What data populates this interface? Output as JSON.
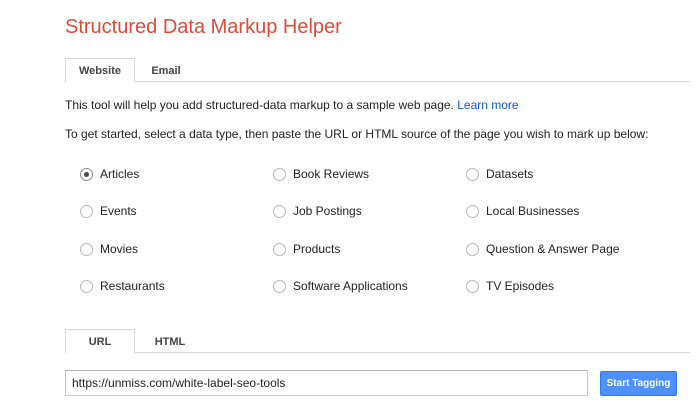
{
  "header": {
    "title": "Structured Data Markup Helper"
  },
  "top_tabs": [
    {
      "label": "Website",
      "active": true
    },
    {
      "label": "Email",
      "active": false
    }
  ],
  "intro": {
    "text": "This tool will help you add structured-data markup to a sample web page. ",
    "link_label": "Learn more"
  },
  "instructions": "To get started, select a data type, then paste the URL or HTML source of the page you wish to mark up below:",
  "data_types": [
    {
      "label": "Articles",
      "checked": true
    },
    {
      "label": "Book Reviews",
      "checked": false
    },
    {
      "label": "Datasets",
      "checked": false
    },
    {
      "label": "Events",
      "checked": false
    },
    {
      "label": "Job Postings",
      "checked": false
    },
    {
      "label": "Local Businesses",
      "checked": false
    },
    {
      "label": "Movies",
      "checked": false
    },
    {
      "label": "Products",
      "checked": false
    },
    {
      "label": "Question & Answer Page",
      "checked": false
    },
    {
      "label": "Restaurants",
      "checked": false
    },
    {
      "label": "Software Applications",
      "checked": false
    },
    {
      "label": "TV Episodes",
      "checked": false
    }
  ],
  "source_tabs": [
    {
      "label": "URL",
      "active": true
    },
    {
      "label": "HTML",
      "active": false
    }
  ],
  "url_field": {
    "value": "https://unmiss.com/white-label-seo-tools"
  },
  "start_button": {
    "label": "Start Tagging"
  },
  "colors": {
    "title": "#dd4b39",
    "link": "#1155cc",
    "button": "#4d90fe"
  }
}
